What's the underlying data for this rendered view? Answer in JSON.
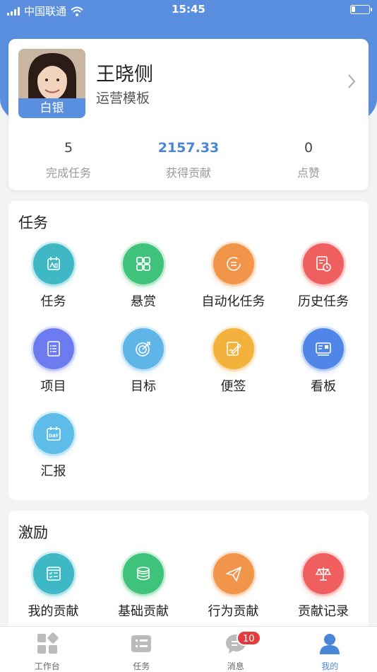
{
  "statusbar": {
    "carrier": "中国联通",
    "time": "15:45"
  },
  "profile": {
    "level_badge": "白银",
    "name": "王晓侧",
    "template": "运营模板",
    "stats": [
      {
        "value": "5",
        "label": "完成任务"
      },
      {
        "value": "2157.33",
        "label": "获得贡献"
      },
      {
        "value": "0",
        "label": "点赞"
      }
    ]
  },
  "tasks_section": {
    "title": "任务",
    "items": [
      {
        "label": "任务",
        "icon": "task-calendar-icon",
        "color": "#3fb8c6"
      },
      {
        "label": "悬赏",
        "icon": "grid-apps-icon",
        "color": "#3fc27a"
      },
      {
        "label": "自动化任务",
        "icon": "auto-refresh-icon",
        "color": "#f0954a"
      },
      {
        "label": "历史任务",
        "icon": "history-doc-icon",
        "color": "#ef5f5f"
      },
      {
        "label": "项目",
        "icon": "project-list-icon",
        "color": "#6c7cf0"
      },
      {
        "label": "目标",
        "icon": "target-icon",
        "color": "#5fb4e8"
      },
      {
        "label": "便签",
        "icon": "note-pen-icon",
        "color": "#f3b23c"
      },
      {
        "label": "看板",
        "icon": "kanban-board-icon",
        "color": "#4f86e8"
      },
      {
        "label": "汇报",
        "icon": "report-day-icon",
        "color": "#5ebde8"
      }
    ]
  },
  "incentive_section": {
    "title": "激励",
    "items": [
      {
        "label": "我的贡献",
        "icon": "my-contribution-icon",
        "color": "#3fb8c6"
      },
      {
        "label": "基础贡献",
        "icon": "coin-stack-icon",
        "color": "#3fc27a"
      },
      {
        "label": "行为贡献",
        "icon": "paper-plane-icon",
        "color": "#f0954a"
      },
      {
        "label": "贡献记录",
        "icon": "scale-icon",
        "color": "#ef5f5f"
      }
    ]
  },
  "tabbar": {
    "items": [
      {
        "label": "工作台",
        "icon": "workbench-icon"
      },
      {
        "label": "任务",
        "icon": "task-list-icon"
      },
      {
        "label": "消息",
        "icon": "message-icon",
        "badge": "10"
      },
      {
        "label": "我的",
        "icon": "profile-person-icon",
        "active": true
      }
    ]
  }
}
